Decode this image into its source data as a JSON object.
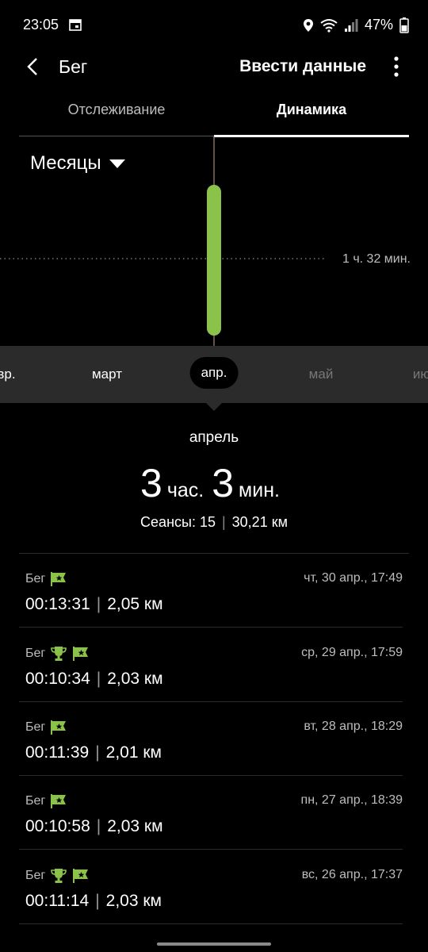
{
  "status": {
    "time": "23:05",
    "battery": "47%"
  },
  "appbar": {
    "title": "Бег",
    "enter_data": "Ввести данные"
  },
  "tabs": [
    {
      "label": "Отслеживание"
    },
    {
      "label": "Динамика"
    }
  ],
  "period_selector": {
    "label": "Месяцы"
  },
  "chart": {
    "average_label": "1 ч. 32 мин."
  },
  "months": [
    {
      "label": "вр."
    },
    {
      "label": "март"
    },
    {
      "label": "апр."
    },
    {
      "label": "май"
    },
    {
      "label": "ию"
    }
  ],
  "summary": {
    "month": "апрель",
    "hours": "3",
    "hours_unit": "час.",
    "minutes": "3",
    "minutes_unit": "мин.",
    "sessions": "Сеансы: 15",
    "distance": "30,21 км"
  },
  "entries": [
    {
      "kind": "Бег",
      "date": "чт, 30 апр., 17:49",
      "time": "00:13:31",
      "distance": "2,05 км"
    },
    {
      "kind": "Бег",
      "date": "ср, 29 апр., 17:59",
      "time": "00:10:34",
      "distance": "2,03 км"
    },
    {
      "kind": "Бег",
      "date": "вт, 28 апр., 18:29",
      "time": "00:11:39",
      "distance": "2,01 км"
    },
    {
      "kind": "Бег",
      "date": "пн, 27 апр., 18:39",
      "time": "00:10:58",
      "distance": "2,03 км"
    },
    {
      "kind": "Бег",
      "date": "вс, 26 апр., 17:37",
      "time": "00:11:14",
      "distance": "2,03 км"
    }
  ],
  "colors": {
    "accent": "#8bc34a",
    "background": "#000000",
    "panel": "#2b2b2b"
  }
}
